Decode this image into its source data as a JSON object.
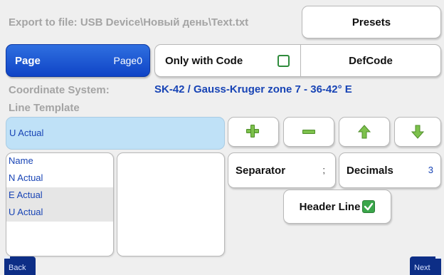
{
  "export": {
    "label": "Export to file: USB Device\\Новый день\\Text.txt"
  },
  "presets": {
    "label": "Presets"
  },
  "page": {
    "label": "Page",
    "value": "Page0"
  },
  "only_with_code": {
    "label": "Only with Code",
    "checked": false
  },
  "defcode": {
    "label": "DefCode"
  },
  "coordinate_system": {
    "label": "Coordinate System:",
    "value": "SK-42 / Gauss-Kruger zone 7 - 36-42° E"
  },
  "line_template": {
    "label": "Line Template",
    "value": "U Actual"
  },
  "fields_list": {
    "items": [
      "Name",
      "N Actual",
      "E Actual",
      "U Actual"
    ]
  },
  "selected_list": {
    "items": []
  },
  "toolbar": {
    "icons": [
      "plus-icon",
      "minus-icon",
      "arrow-up-icon",
      "arrow-down-icon"
    ]
  },
  "separator": {
    "label": "Separator",
    "value": ";"
  },
  "decimals": {
    "label": "Decimals",
    "value": "3"
  },
  "header_line": {
    "label": "Header Line",
    "checked": true
  },
  "nav": {
    "back_label": "Back",
    "next_label": "Next"
  },
  "colors": {
    "accent": "#0f44c6",
    "text_blue": "#1844b5",
    "green": "#3aa64a",
    "template_bg": "#bfe1f7"
  }
}
